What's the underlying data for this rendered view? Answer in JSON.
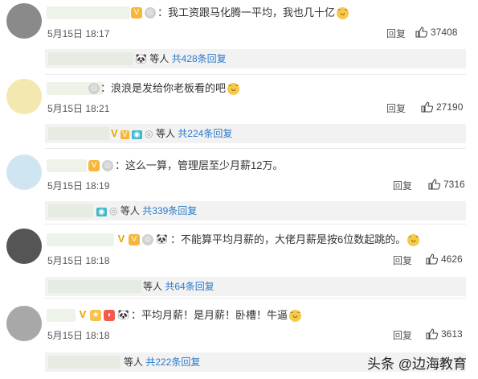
{
  "comments": [
    {
      "text": "：我工资跟马化腾一平均，我也几十亿",
      "time": "5月15日 18:17",
      "reply": "回复",
      "likes": "37408",
      "sub": {
        "prefix": "等人",
        "link": "共428条回复"
      }
    },
    {
      "text": "：浪浪是发给你老板看的吧",
      "time": "5月15日 18:21",
      "reply": "回复",
      "likes": "27190",
      "sub": {
        "prefix": "等人",
        "link": "共224条回复"
      }
    },
    {
      "text": "：这么一算，管理层至少月薪12万。",
      "time": "5月15日 18:19",
      "reply": "回复",
      "likes": "7316",
      "sub": {
        "prefix": "等人",
        "link": "共339条回复"
      }
    },
    {
      "text": "：不能算平均月薪的，大佬月薪是按6位数起跳的。",
      "time": "5月15日 18:18",
      "reply": "回复",
      "likes": "4626",
      "sub": {
        "prefix": "等人",
        "link": "共64条回复"
      }
    },
    {
      "text": "：平均月薪！是月薪！卧槽！牛逼",
      "time": "5月15日 18:18",
      "reply": "回复",
      "likes": "3613",
      "sub": {
        "prefix": "等人",
        "link": "共222条回复"
      }
    }
  ],
  "watermark": "头条 @边海教育",
  "colors": {
    "link": "#2b7bcc",
    "sub_bg": "#f2f2f2"
  }
}
